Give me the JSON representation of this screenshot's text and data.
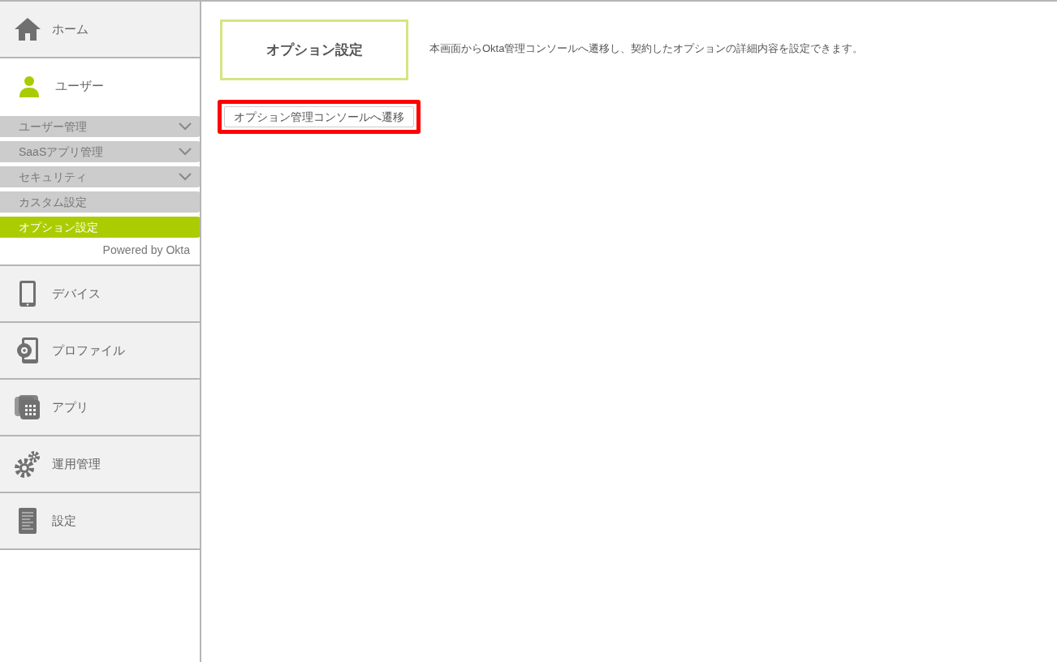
{
  "sidebar": {
    "items": [
      {
        "label": "ホーム",
        "selected": false
      },
      {
        "label": "ユーザー",
        "selected": true,
        "children": [
          {
            "label": "ユーザー管理",
            "expandable": true,
            "selected": false
          },
          {
            "label": "SaaSアプリ管理",
            "expandable": true,
            "selected": false
          },
          {
            "label": "セキュリティ",
            "expandable": true,
            "selected": false
          },
          {
            "label": "カスタム設定",
            "expandable": false,
            "selected": false
          },
          {
            "label": "オプション設定",
            "expandable": false,
            "selected": true
          }
        ],
        "footer": "Powered by Okta"
      },
      {
        "label": "デバイス",
        "selected": false
      },
      {
        "label": "プロファイル",
        "selected": false
      },
      {
        "label": "アプリ",
        "selected": false
      },
      {
        "label": "運用管理",
        "selected": false
      },
      {
        "label": "設定",
        "selected": false
      }
    ]
  },
  "page": {
    "title": "オプション設定",
    "description": "本画面からOkta管理コンソールへ遷移し、契約したオプションの詳細内容を設定できます。",
    "button": {
      "label": "オプション管理コンソールへ遷移",
      "highlighted": true
    }
  }
}
